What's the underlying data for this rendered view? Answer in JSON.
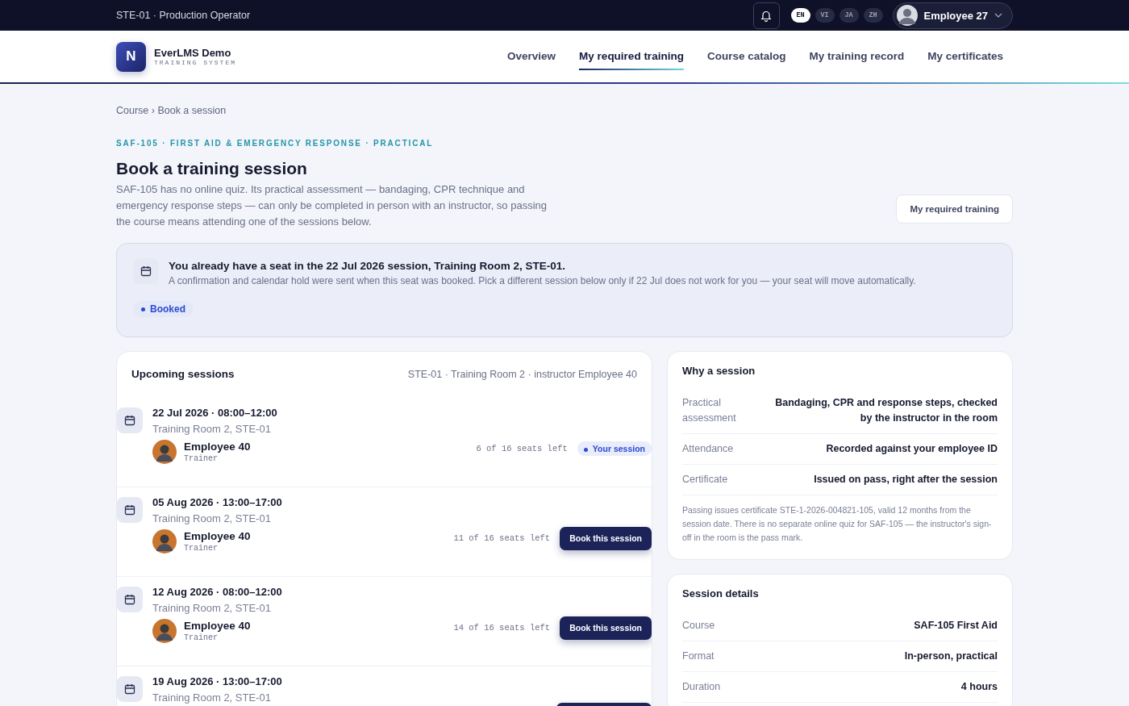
{
  "topbar": {
    "context": "STE-01 · Production Operator",
    "languages": [
      {
        "label": "EN",
        "selected": true
      },
      {
        "label": "VI",
        "selected": false
      },
      {
        "label": "JA",
        "selected": false
      },
      {
        "label": "ZH",
        "selected": false
      }
    ],
    "user": "Employee 27"
  },
  "brand": {
    "initial": "N",
    "name": "EverLMS Demo",
    "tagline": "TRAINING SYSTEM"
  },
  "nav": [
    {
      "label": "Overview",
      "selected": false
    },
    {
      "label": "My required training",
      "selected": true
    },
    {
      "label": "Course catalog",
      "selected": false
    },
    {
      "label": "My training record",
      "selected": false
    },
    {
      "label": "My certificates",
      "selected": false
    }
  ],
  "breadcrumb": "Course › Book a session",
  "eyebrow": "SAF-105 · FIRST AID & EMERGENCY RESPONSE · PRACTICAL",
  "title": "Book a training session",
  "description": "SAF-105 has no online quiz. Its practical assessment — bandaging, CPR technique and emergency response steps — can only be completed in person with an instructor, so passing the course means attending one of the sessions below.",
  "back_button": "My required training",
  "notice": {
    "title": "You already have a seat in the 22 Jul 2026 session, Training Room 2, STE-01.",
    "text": "A confirmation and calendar hold were sent when this seat was booked. Pick a different session below only if 22 Jul does not work for you — your seat will move automatically.",
    "status": "Booked"
  },
  "sessions": {
    "title": "Upcoming sessions",
    "subtitle": "STE-01 · Training Room 2 · instructor Employee 40",
    "items": [
      {
        "kind": "booked",
        "date": "22 Jul 2026 · 08:00–12:00",
        "room": "Training Room 2, STE-01",
        "trainer": "Employee 40",
        "role": "Trainer",
        "seats": "6 of 16 seats left",
        "action": "Your session"
      },
      {
        "kind": "open",
        "date": "05 Aug 2026 · 13:00–17:00",
        "room": "Training Room 2, STE-01",
        "trainer": "Employee 40",
        "role": "Trainer",
        "seats": "11 of 16 seats left",
        "action": "Book this session"
      },
      {
        "kind": "open",
        "date": "12 Aug 2026 · 08:00–12:00",
        "room": "Training Room 2, STE-01",
        "trainer": "Employee 40",
        "role": "Trainer",
        "seats": "14 of 16 seats left",
        "action": "Book this session"
      },
      {
        "kind": "open",
        "date": "19 Aug 2026 · 13:00–17:00",
        "room": "Training Room 2, STE-01"
      }
    ]
  },
  "why": {
    "title": "Why a session",
    "rows": [
      {
        "label": "Practical assessment",
        "value": "Bandaging, CPR and response steps, checked by the instructor in the room"
      },
      {
        "label": "Attendance",
        "value": "Recorded against your employee ID"
      },
      {
        "label": "Certificate",
        "value": "Issued on pass, right after the session"
      }
    ],
    "note": "Passing issues certificate STE-1-2026-004821-105, valid 12 months from the session date. There is no separate online quiz for SAF-105 — the instructor's sign-off in the room is the pass mark."
  },
  "details": {
    "title": "Session details",
    "rows": [
      {
        "label": "Course",
        "value": "SAF-105 First Aid"
      },
      {
        "label": "Format",
        "value": "In-person, practical"
      },
      {
        "label": "Duration",
        "value": "4 hours"
      }
    ]
  }
}
